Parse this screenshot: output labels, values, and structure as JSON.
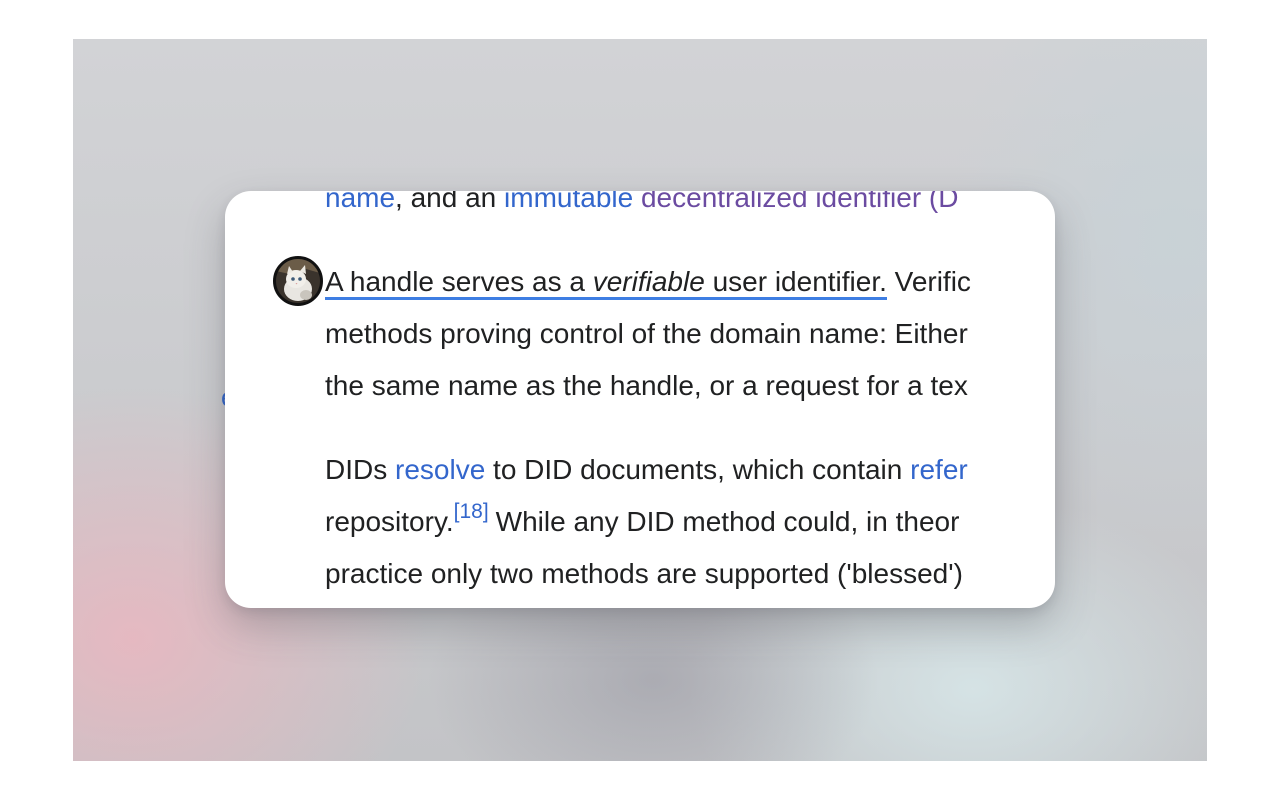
{
  "background": {
    "side_fragment": "e"
  },
  "card": {
    "line0": {
      "name_link": "name",
      "middle": ", and an ",
      "immutable_link": "immutable",
      "space": " ",
      "did_link": "decentralized identifier (D"
    },
    "paragraph1": {
      "highlight_a": "A handle serves as a ",
      "highlight_em": "verifiable",
      "highlight_b": " user identifier.",
      "line1_rest": " Verific",
      "line2": "methods proving control of the domain name: Either",
      "line3": "the same name as the handle, or a request for a tex"
    },
    "paragraph2": {
      "line1_a": "DIDs ",
      "resolve_link": "resolve",
      "line1_b": " to DID documents, which contain ",
      "refer_link": "refer",
      "line2_a": "repository.",
      "citation": "[18]",
      "line2_b": "While any DID method could, in theor",
      "line3": "practice only two methods are supported ('blessed')"
    },
    "avatar": {
      "icon": "kitten-avatar-icon"
    }
  },
  "colors": {
    "link": "#3366cc",
    "visited_link": "#6b4ba1",
    "highlight_underline": "#3e7ee3",
    "body_text": "#202122"
  }
}
